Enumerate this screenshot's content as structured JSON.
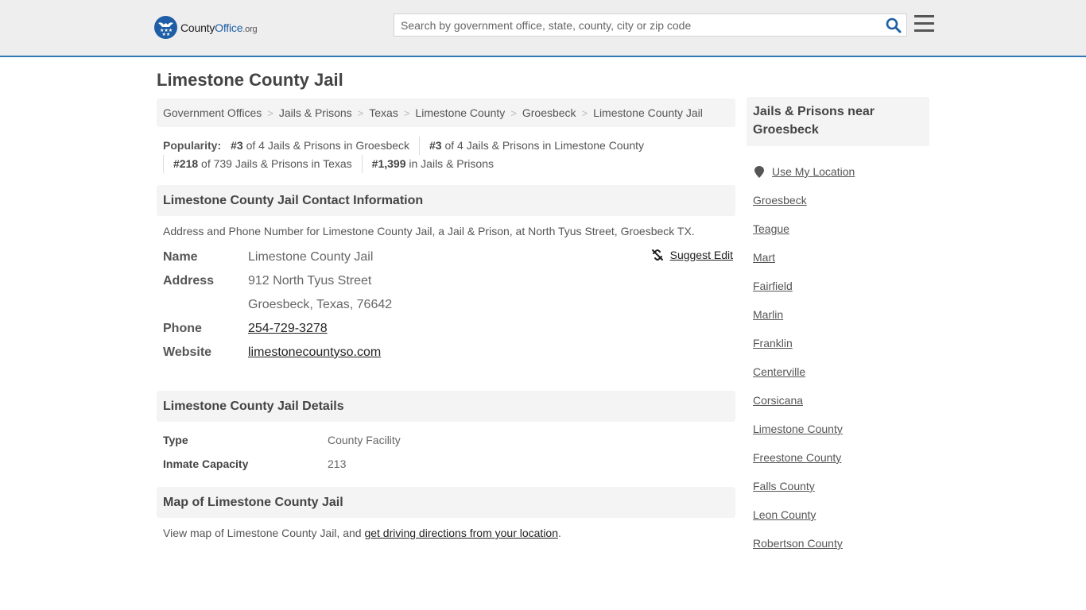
{
  "header": {
    "logo": {
      "county": "County",
      "office": "Office",
      "org": ".org"
    },
    "search_placeholder": "Search by government office, state, county, city or zip code",
    "search_value": "",
    "accent_color": "#2f77b5"
  },
  "page_title": "Limestone County Jail",
  "breadcrumb": [
    "Government Offices",
    "Jails & Prisons",
    "Texas",
    "Limestone County",
    "Groesbeck",
    "Limestone County Jail"
  ],
  "breadcrumb_separator": ">",
  "popularity": {
    "label": "Popularity:",
    "items": [
      {
        "rank": "#3",
        "text": " of 4 Jails & Prisons in Groesbeck"
      },
      {
        "rank": "#3",
        "text": " of 4 Jails & Prisons in Limestone County"
      },
      {
        "rank": "#218",
        "text": " of 739 Jails & Prisons in Texas"
      },
      {
        "rank": "#1,399",
        "text": " in Jails & Prisons"
      }
    ]
  },
  "contact": {
    "heading": "Limestone County Jail Contact Information",
    "description": "Address and Phone Number for Limestone County Jail, a Jail & Prison, at North Tyus Street, Groesbeck TX.",
    "suggest_edit": "Suggest Edit",
    "fields": {
      "name_label": "Name",
      "name": "Limestone County Jail",
      "address_label": "Address",
      "address_line1": "912 North Tyus Street",
      "address_line2": "Groesbeck, Texas, 76642",
      "phone_label": "Phone",
      "phone": "254-729-3278",
      "website_label": "Website",
      "website": "limestonecountyso.com"
    }
  },
  "details": {
    "heading": "Limestone County Jail Details",
    "rows": [
      {
        "label": "Type",
        "value": "County Facility"
      },
      {
        "label": "Inmate Capacity",
        "value": "213"
      }
    ]
  },
  "map": {
    "heading": "Map of Limestone County Jail",
    "text_before": "View map of Limestone County Jail, and ",
    "link": "get driving directions from your location",
    "text_after": "."
  },
  "sidebar": {
    "heading": "Jails & Prisons near Groesbeck",
    "use_location": "Use My Location",
    "items": [
      "Groesbeck",
      "Teague",
      "Mart",
      "Fairfield",
      "Marlin",
      "Franklin",
      "Centerville",
      "Corsicana",
      "Limestone County",
      "Freestone County",
      "Falls County",
      "Leon County",
      "Robertson County"
    ]
  }
}
